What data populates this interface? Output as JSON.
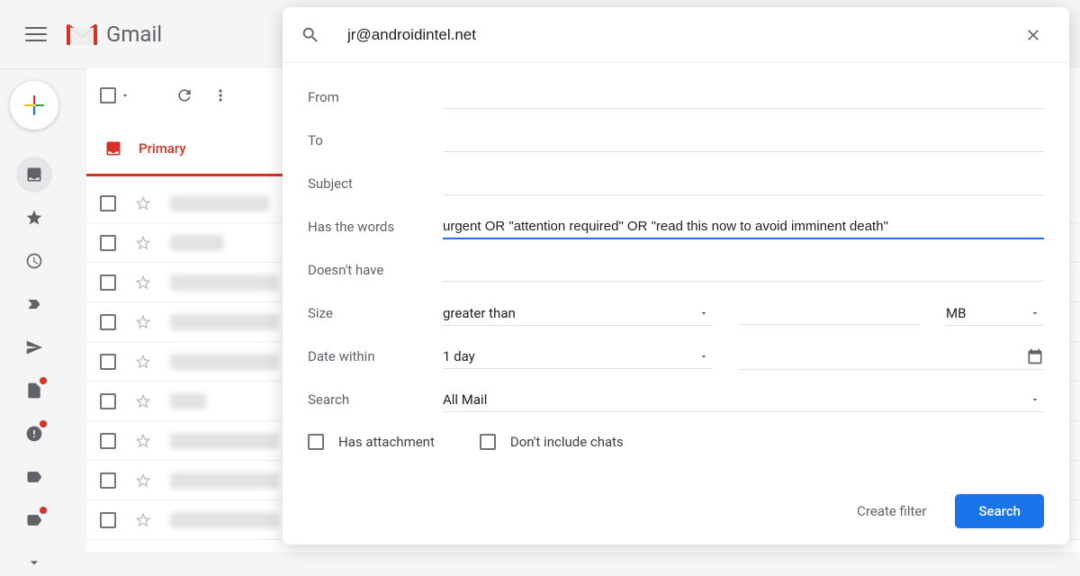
{
  "header": {
    "logo_text": "Gmail"
  },
  "toolbar": {
    "primary_tab_label": "Primary"
  },
  "search": {
    "query": "jr@androidintel.net",
    "fields": {
      "from_label": "From",
      "from_value": "",
      "to_label": "To",
      "to_value": "",
      "subject_label": "Subject",
      "subject_value": "",
      "has_words_label": "Has the words",
      "has_words_value": "urgent OR \"attention required\" OR \"read this now to avoid imminent death\"",
      "doesnt_have_label": "Doesn't have",
      "doesnt_have_value": "",
      "size_label": "Size",
      "size_op": "greater than",
      "size_value": "",
      "size_unit": "MB",
      "date_within_label": "Date within",
      "date_within_value": "1 day",
      "date_value": "",
      "search_label": "Search",
      "search_scope": "All Mail",
      "has_attachment_label": "Has attachment",
      "dont_include_chats_label": "Don't include chats"
    },
    "actions": {
      "create_filter": "Create filter",
      "search": "Search"
    }
  }
}
